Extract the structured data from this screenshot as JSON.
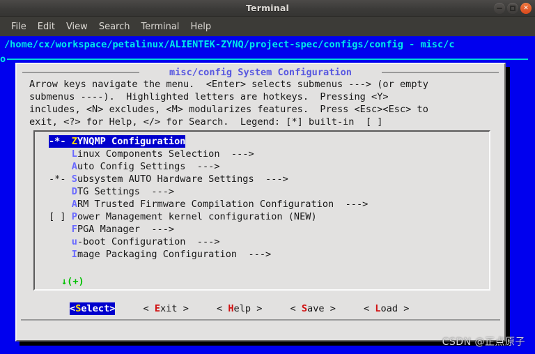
{
  "window": {
    "title": "Terminal",
    "buttons": [
      {
        "name": "minimize",
        "glyph": "–"
      },
      {
        "name": "maximize",
        "glyph": "□"
      },
      {
        "name": "close",
        "glyph": "×"
      }
    ]
  },
  "menubar": {
    "items": [
      {
        "label": "File"
      },
      {
        "label": "Edit"
      },
      {
        "label": "View"
      },
      {
        "label": "Search"
      },
      {
        "label": "Terminal"
      },
      {
        "label": "Help"
      }
    ]
  },
  "terminal": {
    "path_line": "/home/cx/workspace/petalinux/ALIENTEK-ZYNQ/project-spec/configs/config - misc/c",
    "rule_marker": "o"
  },
  "dialog": {
    "title": "misc/config System Configuration",
    "help_text": "Arrow keys navigate the menu.  <Enter> selects submenus ---> (or empty\nsubmenus ----).  Highlighted letters are hotkeys.  Pressing <Y>\nincludes, <N> excludes, <M> modularizes features.  Press <Esc><Esc> to\nexit, <?> for Help, </> for Search.  Legend: [*] built-in  [ ]",
    "menu": {
      "items": [
        {
          "prefix": "-*- ",
          "hotkey": "Z",
          "text": "YNQMP Configuration",
          "suffix": "",
          "selected": true
        },
        {
          "prefix": "    ",
          "hotkey": "L",
          "text": "inux Components Selection",
          "suffix": "  --->",
          "selected": false
        },
        {
          "prefix": "    ",
          "hotkey": "A",
          "text": "uto Config Settings",
          "suffix": "  --->",
          "selected": false
        },
        {
          "prefix": "-*- ",
          "hotkey": "S",
          "text": "ubsystem AUTO Hardware Settings",
          "suffix": "  --->",
          "selected": false
        },
        {
          "prefix": "    ",
          "hotkey": "D",
          "text": "TG Settings",
          "suffix": "  --->",
          "selected": false
        },
        {
          "prefix": "    ",
          "hotkey": "A",
          "text": "RM Trusted Firmware Compilation Configuration",
          "suffix": "  --->",
          "selected": false
        },
        {
          "prefix": "[ ] ",
          "hotkey": "P",
          "text": "ower Management kernel configuration (NEW)",
          "suffix": "",
          "selected": false
        },
        {
          "prefix": "    ",
          "hotkey": "F",
          "text": "PGA Manager",
          "suffix": "  --->",
          "selected": false
        },
        {
          "prefix": "    ",
          "hotkey": "u",
          "text": "-boot Configuration",
          "suffix": "  --->",
          "selected": false
        },
        {
          "prefix": "    ",
          "hotkey": "I",
          "text": "mage Packaging Configuration",
          "suffix": "  --->",
          "selected": false
        }
      ],
      "scroll_indicator": "↓(+)"
    },
    "buttons": [
      {
        "pre": "<",
        "hotkey": "S",
        "post": "elect>",
        "active": true
      },
      {
        "pre": "< ",
        "hotkey": "E",
        "post": "xit >",
        "active": false
      },
      {
        "pre": "< ",
        "hotkey": "H",
        "post": "elp >",
        "active": false
      },
      {
        "pre": "< ",
        "hotkey": "S",
        "post": "ave >",
        "active": false
      },
      {
        "pre": "< ",
        "hotkey": "L",
        "post": "oad >",
        "active": false
      }
    ]
  },
  "watermark": "CSDN @正点原子",
  "colors": {
    "terminal_background": "#0000ee",
    "path_text": "#00eaea",
    "dialog_background": "#e2e1e0",
    "dialog_title": "#5757e0",
    "hotkey": "#6a6aff",
    "selection_background": "#0000cd",
    "selection_hotkey": "#ffe000",
    "button_hotkey": "#d01010",
    "scroll_indicator": "#00c000"
  }
}
